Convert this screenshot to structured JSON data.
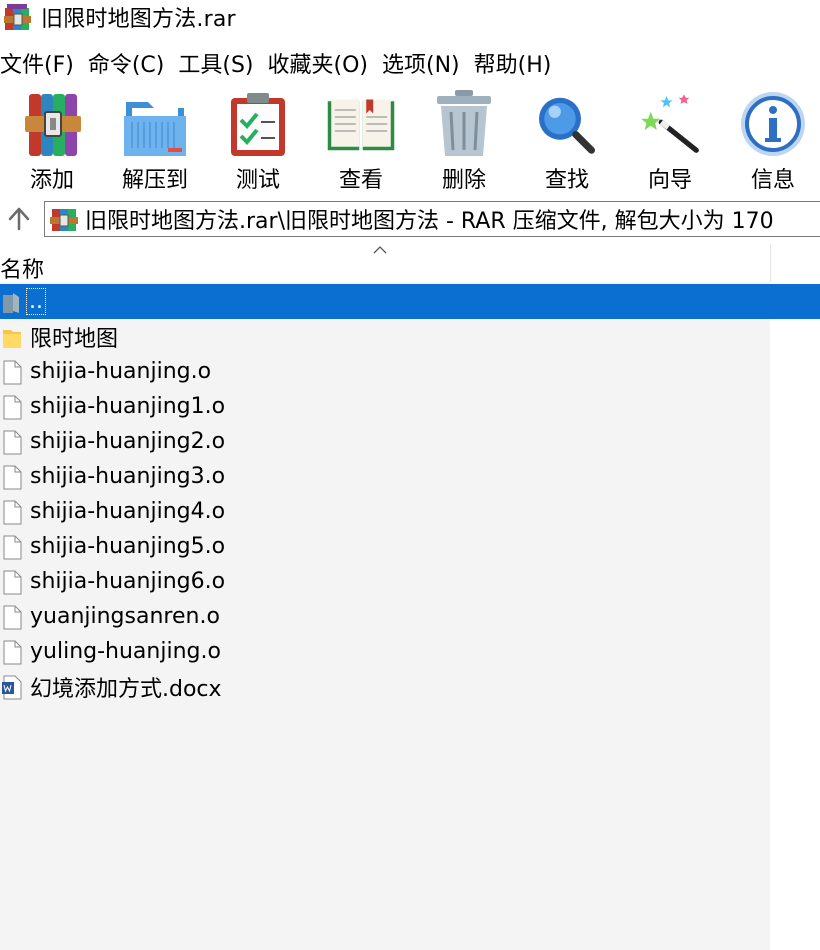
{
  "window": {
    "title": "旧限时地图方法.rar"
  },
  "menu": [
    "文件(F)",
    "命令(C)",
    "工具(S)",
    "收藏夹(O)",
    "选项(N)",
    "帮助(H)"
  ],
  "toolbar": [
    {
      "label": "添加",
      "icon": "add-archive-icon"
    },
    {
      "label": "解压到",
      "icon": "extract-folder-icon"
    },
    {
      "label": "测试",
      "icon": "test-clipboard-icon"
    },
    {
      "label": "查看",
      "icon": "view-book-icon"
    },
    {
      "label": "删除",
      "icon": "delete-trash-icon"
    },
    {
      "label": "查找",
      "icon": "find-magnifier-icon"
    },
    {
      "label": "向导",
      "icon": "wizard-wand-icon"
    },
    {
      "label": "信息",
      "icon": "info-icon"
    }
  ],
  "address": {
    "path": "旧限时地图方法.rar\\旧限时地图方法 - RAR 压缩文件, 解包大小为 170"
  },
  "list": {
    "column_name": "名称",
    "rows": [
      {
        "name": "..",
        "icon": "parent-folder-icon",
        "selected": true
      },
      {
        "name": "限时地图",
        "icon": "folder-icon"
      },
      {
        "name": "shijia-huanjing.o",
        "icon": "file-icon"
      },
      {
        "name": "shijia-huanjing1.o",
        "icon": "file-icon"
      },
      {
        "name": "shijia-huanjing2.o",
        "icon": "file-icon"
      },
      {
        "name": "shijia-huanjing3.o",
        "icon": "file-icon"
      },
      {
        "name": "shijia-huanjing4.o",
        "icon": "file-icon"
      },
      {
        "name": "shijia-huanjing5.o",
        "icon": "file-icon"
      },
      {
        "name": "shijia-huanjing6.o",
        "icon": "file-icon"
      },
      {
        "name": "yuanjingsanren.o",
        "icon": "file-icon"
      },
      {
        "name": "yuling-huanjing.o",
        "icon": "file-icon"
      },
      {
        "name": "幻境添加方式.docx",
        "icon": "word-document-icon"
      }
    ]
  },
  "colors": {
    "selection": "#0a6fd0",
    "list_background": "#f4f4f4"
  }
}
